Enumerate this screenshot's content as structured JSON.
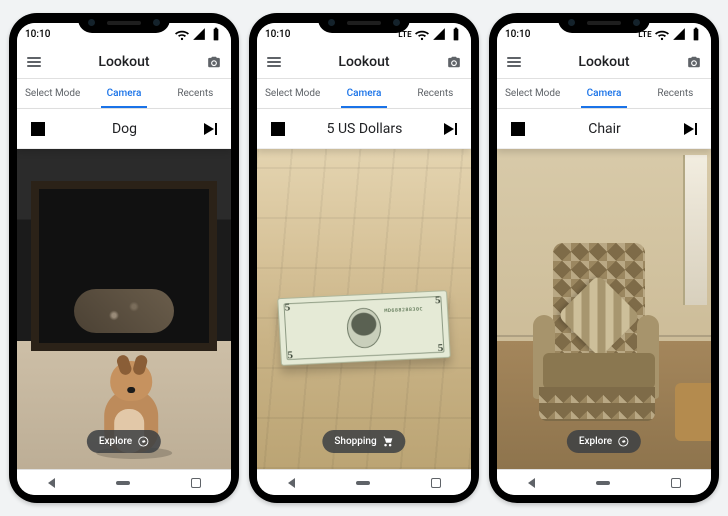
{
  "status": {
    "time": "10:10",
    "network_label": "LTE"
  },
  "app": {
    "title": "Lookout"
  },
  "tabs": {
    "select_mode": "Select Mode",
    "camera": "Camera",
    "recents": "Recents",
    "active": "camera"
  },
  "modes": {
    "explore": "Explore",
    "shopping": "Shopping"
  },
  "phones": [
    {
      "result_label": "Dog",
      "mode_key": "explore",
      "scene": "dog",
      "show_lte": false
    },
    {
      "result_label": "5 US Dollars",
      "mode_key": "shopping",
      "scene": "cash",
      "show_lte": true
    },
    {
      "result_label": "Chair",
      "mode_key": "explore",
      "scene": "chair",
      "show_lte": true
    }
  ],
  "bill": {
    "denomination": "5",
    "serial": "MD68828830C"
  }
}
